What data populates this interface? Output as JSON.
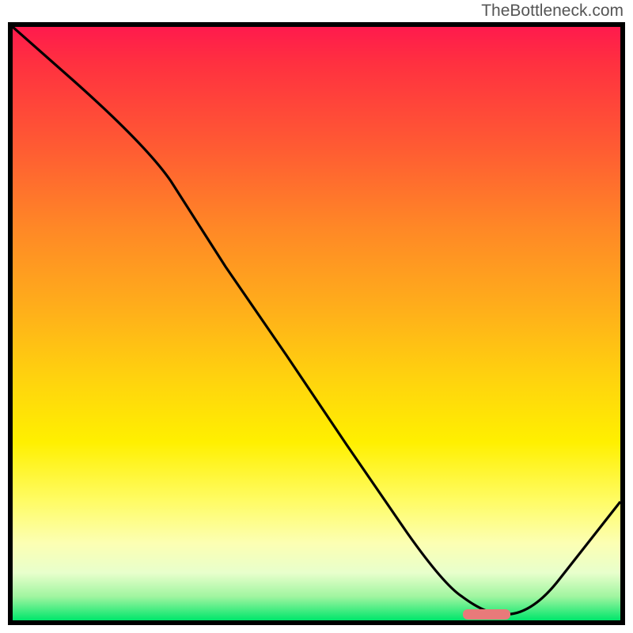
{
  "watermark": "TheBottleneck.com",
  "chart_data": {
    "type": "line",
    "title": "",
    "xlabel": "",
    "ylabel": "",
    "xlim": [
      0,
      100
    ],
    "ylim": [
      0,
      100
    ],
    "series": [
      {
        "name": "curve",
        "x": [
          0,
          10,
          22,
          30,
          40,
          50,
          60,
          70,
          74,
          80,
          82,
          90,
          100
        ],
        "values": [
          100,
          91,
          80,
          70,
          55,
          40,
          25,
          10,
          4,
          1,
          1,
          7,
          20
        ]
      }
    ],
    "marker": {
      "x_start": 74,
      "x_end": 80,
      "y": 1
    },
    "gradient_stops": [
      {
        "pos": 0,
        "color": "#ff1a4d"
      },
      {
        "pos": 20,
        "color": "#ff5a33"
      },
      {
        "pos": 48,
        "color": "#ffb01a"
      },
      {
        "pos": 70,
        "color": "#fff000"
      },
      {
        "pos": 87,
        "color": "#fcffb3"
      },
      {
        "pos": 100,
        "color": "#00e66b"
      }
    ]
  }
}
